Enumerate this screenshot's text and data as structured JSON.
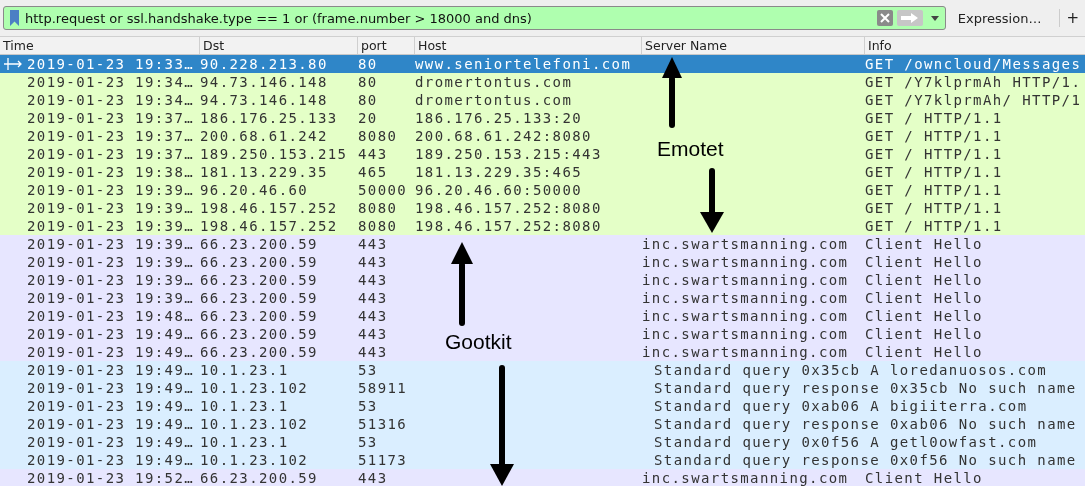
{
  "filter": {
    "value": "http.request or ssl.handshake.type == 1 or (frame.number > 18000 and dns)"
  },
  "expression_button": "Expression…",
  "add_button": "+",
  "columns": [
    "Time",
    "Dst",
    "port",
    "Host",
    "Server Name",
    "Info"
  ],
  "rows": [
    {
      "time": "2019-01-23 19:33…",
      "dst": "90.228.213.80",
      "port": "80",
      "host": "www.seniortelefoni.com",
      "server_name": "",
      "info": "GET /owncloud/Messages",
      "selected": true
    },
    {
      "time": "2019-01-23 19:34…",
      "dst": "94.73.146.148",
      "port": "80",
      "host": "dromertontus.com",
      "server_name": "",
      "info": "GET /Y7klprmAh HTTP/1.",
      "color": "#e4ffc7",
      "selected": false
    },
    {
      "time": "2019-01-23 19:34…",
      "dst": "94.73.146.148",
      "port": "80",
      "host": "dromertontus.com",
      "server_name": "",
      "info": "GET /Y7klprmAh/ HTTP/1",
      "color": "#e4ffc7",
      "selected": false
    },
    {
      "time": "2019-01-23 19:37…",
      "dst": "186.176.25.133",
      "port": "20",
      "host": "186.176.25.133:20",
      "server_name": "",
      "info": "GET / HTTP/1.1",
      "color": "#e4ffc7",
      "selected": false
    },
    {
      "time": "2019-01-23 19:37…",
      "dst": "200.68.61.242",
      "port": "8080",
      "host": "200.68.61.242:8080",
      "server_name": "",
      "info": "GET / HTTP/1.1",
      "color": "#e4ffc7",
      "selected": false
    },
    {
      "time": "2019-01-23 19:37…",
      "dst": "189.250.153.215",
      "port": "443",
      "host": "189.250.153.215:443",
      "server_name": "",
      "info": "GET / HTTP/1.1",
      "color": "#e4ffc7",
      "selected": false
    },
    {
      "time": "2019-01-23 19:38…",
      "dst": "181.13.229.35",
      "port": "465",
      "host": "181.13.229.35:465",
      "server_name": "",
      "info": "GET / HTTP/1.1",
      "color": "#e4ffc7",
      "selected": false
    },
    {
      "time": "2019-01-23 19:39…",
      "dst": "96.20.46.60",
      "port": "50000",
      "host": "96.20.46.60:50000",
      "server_name": "",
      "info": "GET / HTTP/1.1",
      "color": "#e4ffc7",
      "selected": false
    },
    {
      "time": "2019-01-23 19:39…",
      "dst": "198.46.157.252",
      "port": "8080",
      "host": "198.46.157.252:8080",
      "server_name": "",
      "info": "GET / HTTP/1.1",
      "color": "#e4ffc7",
      "selected": false
    },
    {
      "time": "2019-01-23 19:39…",
      "dst": "198.46.157.252",
      "port": "8080",
      "host": "198.46.157.252:8080",
      "server_name": "",
      "info": "GET / HTTP/1.1",
      "color": "#e4ffc7",
      "selected": false
    },
    {
      "time": "2019-01-23 19:39…",
      "dst": "66.23.200.59",
      "port": "443",
      "host": "",
      "server_name": "inc.swartsmanning.com",
      "info": "Client Hello",
      "color": "#e7e6ff",
      "selected": false
    },
    {
      "time": "2019-01-23 19:39…",
      "dst": "66.23.200.59",
      "port": "443",
      "host": "",
      "server_name": "inc.swartsmanning.com",
      "info": "Client Hello",
      "color": "#e7e6ff",
      "selected": false
    },
    {
      "time": "2019-01-23 19:39…",
      "dst": "66.23.200.59",
      "port": "443",
      "host": "",
      "server_name": "inc.swartsmanning.com",
      "info": "Client Hello",
      "color": "#e7e6ff",
      "selected": false
    },
    {
      "time": "2019-01-23 19:39…",
      "dst": "66.23.200.59",
      "port": "443",
      "host": "",
      "server_name": "inc.swartsmanning.com",
      "info": "Client Hello",
      "color": "#e7e6ff",
      "selected": false
    },
    {
      "time": "2019-01-23 19:48…",
      "dst": "66.23.200.59",
      "port": "443",
      "host": "",
      "server_name": "inc.swartsmanning.com",
      "info": "Client Hello",
      "color": "#e7e6ff",
      "selected": false
    },
    {
      "time": "2019-01-23 19:49…",
      "dst": "66.23.200.59",
      "port": "443",
      "host": "",
      "server_name": "inc.swartsmanning.com",
      "info": "Client Hello",
      "color": "#e7e6ff",
      "selected": false
    },
    {
      "time": "2019-01-23 19:49…",
      "dst": "66.23.200.59",
      "port": "443",
      "host": "",
      "server_name": "inc.swartsmanning.com",
      "info": "Client Hello",
      "color": "#e7e6ff",
      "selected": false
    },
    {
      "time": "2019-01-23 19:49…",
      "dst": "10.1.23.1",
      "port": "53",
      "host": "",
      "server_name": "",
      "info": "Standard query 0x35cb A loredanuosos.com",
      "color": "#daeeff",
      "selected": false
    },
    {
      "time": "2019-01-23 19:49…",
      "dst": "10.1.23.102",
      "port": "58911",
      "host": "",
      "server_name": "",
      "info": "Standard query response 0x35cb No such name",
      "color": "#daeeff",
      "selected": false
    },
    {
      "time": "2019-01-23 19:49…",
      "dst": "10.1.23.1",
      "port": "53",
      "host": "",
      "server_name": "",
      "info": "Standard query 0xab06 A bigiiterra.com",
      "color": "#daeeff",
      "selected": false
    },
    {
      "time": "2019-01-23 19:49…",
      "dst": "10.1.23.102",
      "port": "51316",
      "host": "",
      "server_name": "",
      "info": "Standard query response 0xab06 No such name",
      "color": "#daeeff",
      "selected": false
    },
    {
      "time": "2019-01-23 19:49…",
      "dst": "10.1.23.1",
      "port": "53",
      "host": "",
      "server_name": "",
      "info": "Standard query 0x0f56 A getl0owfast.com",
      "color": "#daeeff",
      "selected": false
    },
    {
      "time": "2019-01-23 19:49…",
      "dst": "10.1.23.102",
      "port": "51173",
      "host": "",
      "server_name": "",
      "info": "Standard query response 0x0f56 No such name",
      "color": "#daeeff",
      "selected": false
    },
    {
      "time": "2019-01-23 19:52…",
      "dst": "66.23.200.59",
      "port": "443",
      "host": "",
      "server_name": "inc.swartsmanning.com",
      "info": "Client Hello",
      "color": "#e7e6ff",
      "selected": false
    }
  ],
  "annotations": [
    {
      "label": "Emotet"
    },
    {
      "label": "Gootkit"
    }
  ]
}
